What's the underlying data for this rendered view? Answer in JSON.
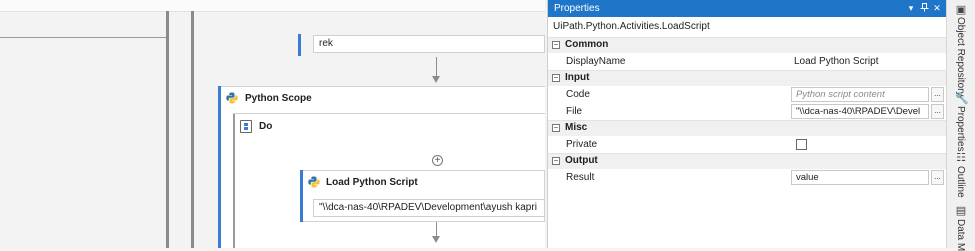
{
  "designer": {
    "top_field_value": "rek",
    "python_scope": {
      "title": "Python Scope"
    },
    "do_sequence": {
      "title": "Do"
    },
    "load_script": {
      "title": "Load Python Script",
      "file_value": "\"\\\\dca-nas-40\\RPADEV\\Development\\ayush kapri"
    }
  },
  "properties": {
    "panel_title": "Properties",
    "activity_type": "UiPath.Python.Activities.LoadScript",
    "categories": {
      "common": {
        "label": "Common",
        "display_name": {
          "label": "DisplayName",
          "value": "Load Python Script"
        }
      },
      "input": {
        "label": "Input",
        "code": {
          "label": "Code",
          "placeholder": "Python script content"
        },
        "file": {
          "label": "File",
          "value": "\"\\\\dca-nas-40\\RPADEV\\Devel"
        }
      },
      "misc": {
        "label": "Misc",
        "private": {
          "label": "Private",
          "checked": false
        }
      },
      "output": {
        "label": "Output",
        "result": {
          "label": "Result",
          "value": "value"
        }
      }
    }
  },
  "dock": {
    "object_repository": "Object Repository",
    "properties": "Properties",
    "outline": "Outline",
    "data_manager": "Data M"
  },
  "colors": {
    "header_blue": "#1f76c8",
    "accent_blue": "#3a7bd5",
    "python_blue": "#3572a5",
    "python_yellow": "#f4c430"
  }
}
